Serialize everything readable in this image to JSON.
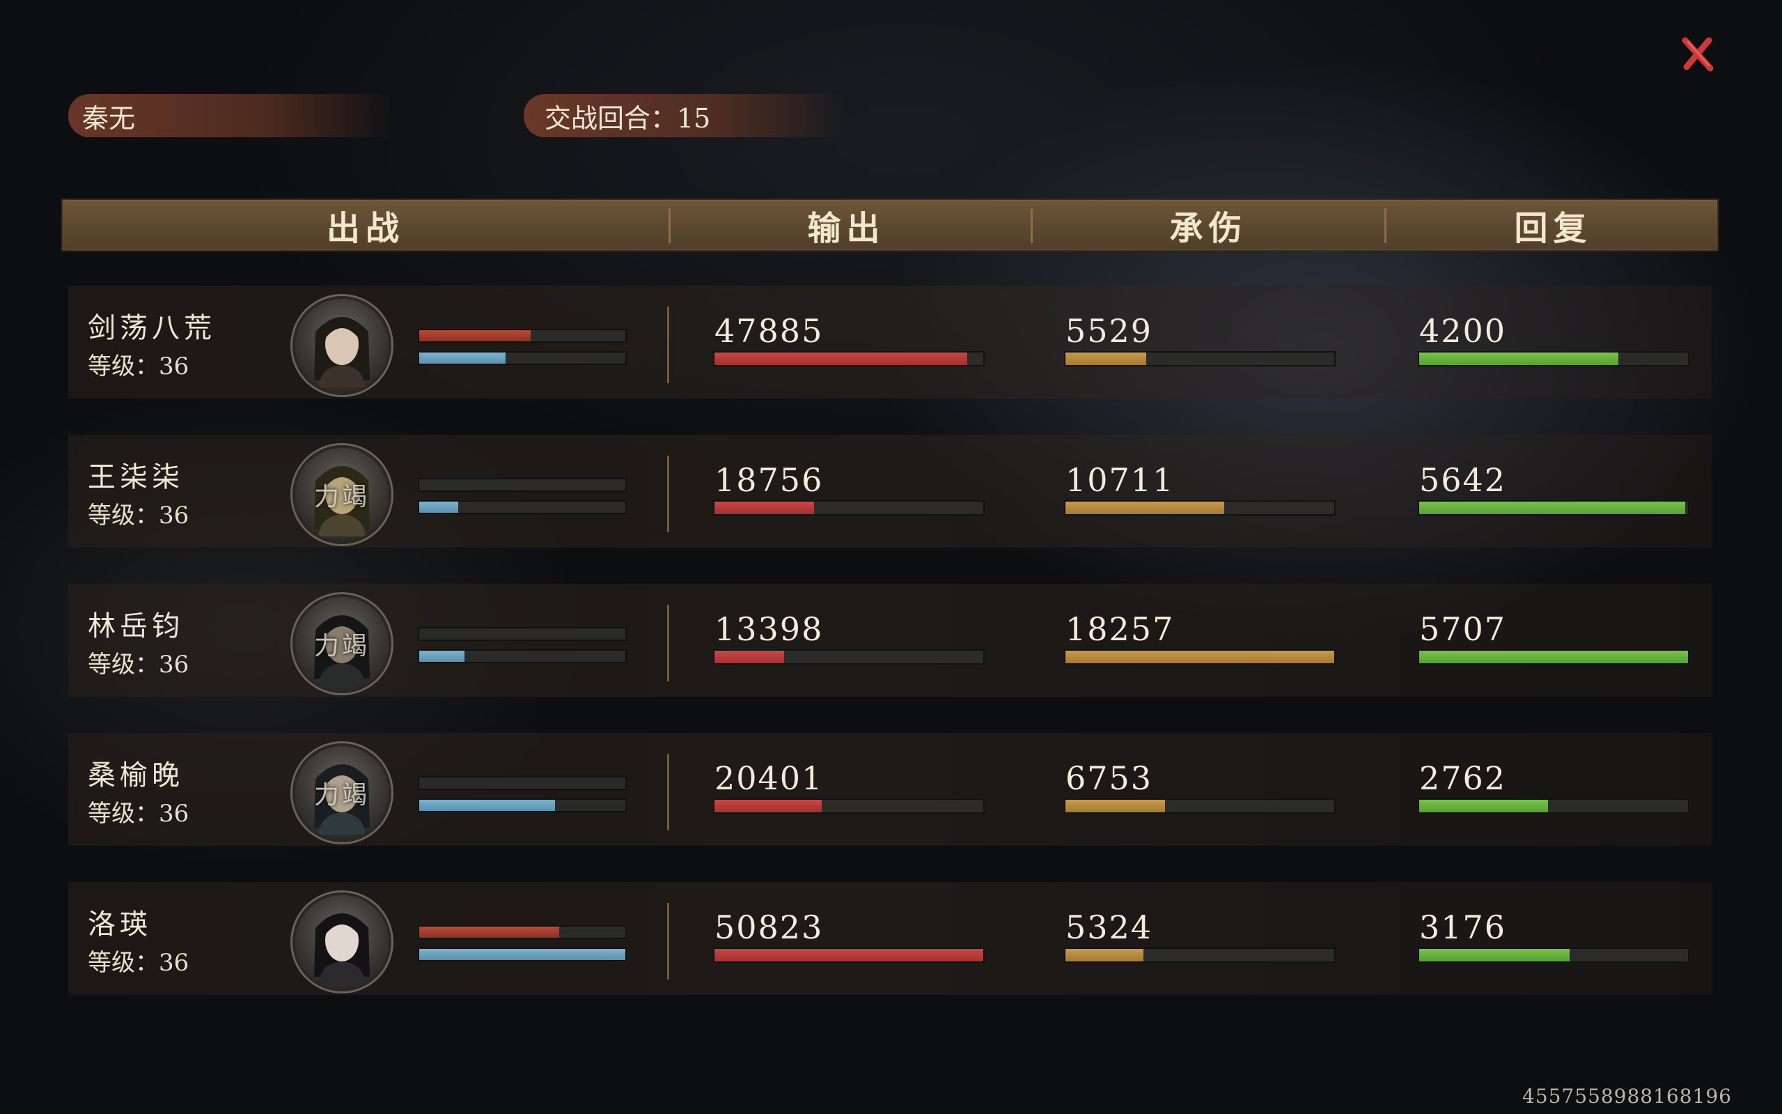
{
  "header": {
    "player_name": "秦无",
    "rounds_label": "交战回合：15"
  },
  "columns": [
    "出战",
    "输出",
    "承伤",
    "回复"
  ],
  "rows": [
    {
      "name": "剑荡八荒",
      "level": "等级：36",
      "avatar_tag": "",
      "hp": 0.54,
      "mp": 0.42,
      "damage": "47885",
      "damage_ratio": 0.94,
      "taken": "5529",
      "taken_ratio": 0.3,
      "heal": "4200",
      "heal_ratio": 0.74
    },
    {
      "name": "王柒柒",
      "level": "等级：36",
      "avatar_tag": "力竭",
      "hp": 0.0,
      "mp": 0.19,
      "damage": "18756",
      "damage_ratio": 0.37,
      "taken": "10711",
      "taken_ratio": 0.59,
      "heal": "5642",
      "heal_ratio": 0.99
    },
    {
      "name": "林岳钧",
      "level": "等级：36",
      "avatar_tag": "力竭",
      "hp": 0.0,
      "mp": 0.22,
      "damage": "13398",
      "damage_ratio": 0.26,
      "taken": "18257",
      "taken_ratio": 1.0,
      "heal": "5707",
      "heal_ratio": 1.0
    },
    {
      "name": "桑榆晚",
      "level": "等级：36",
      "avatar_tag": "力竭",
      "hp": 0.0,
      "mp": 0.66,
      "damage": "20401",
      "damage_ratio": 0.4,
      "taken": "6753",
      "taken_ratio": 0.37,
      "heal": "2762",
      "heal_ratio": 0.48
    },
    {
      "name": "洛瑛",
      "level": "等级：36",
      "avatar_tag": "",
      "hp": 0.68,
      "mp": 1.0,
      "damage": "50823",
      "damage_ratio": 1.0,
      "taken": "5324",
      "taken_ratio": 0.29,
      "heal": "3176",
      "heal_ratio": 0.56
    }
  ],
  "footer": {
    "uid": "4557558988168196"
  },
  "colors": {
    "damage": "#b83a3a",
    "taken": "#b98a40",
    "heal": "#6ab543",
    "hp": "#a8443a",
    "mp": "#6aa4c2"
  }
}
